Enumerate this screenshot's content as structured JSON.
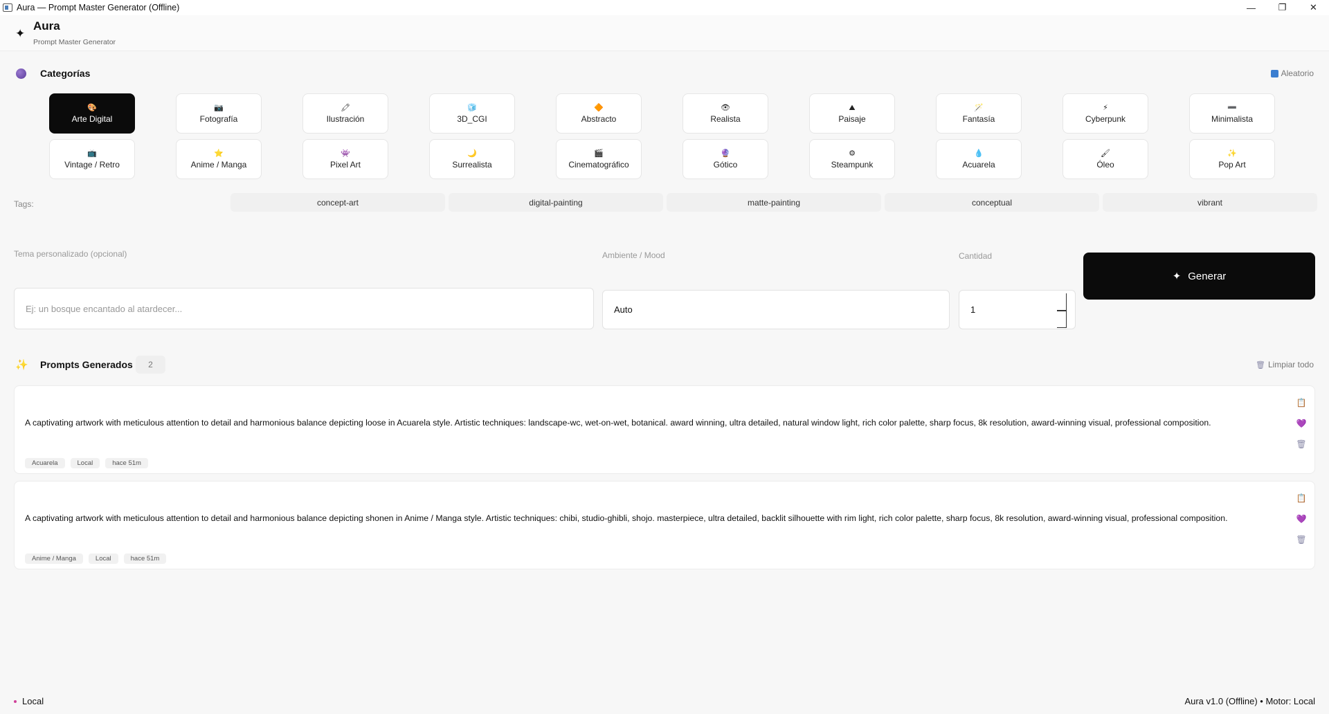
{
  "window": {
    "title": "Aura — Prompt Master Generator (Offline)",
    "controls": {
      "min": "—",
      "restore": "❐",
      "close": "✕"
    }
  },
  "header": {
    "logo_icon": "sparkle-icon",
    "logo": "✦",
    "name": "Aura",
    "subtitle": "Prompt Master Generator"
  },
  "categories": {
    "title": "Categorías",
    "random_label": "Aleatorio",
    "items": [
      {
        "icon": "🎨",
        "label": "Arte Digital",
        "active": true
      },
      {
        "icon": "📷",
        "label": "Fotografía"
      },
      {
        "icon": "🖍",
        "label": "Ilustración"
      },
      {
        "icon": "🧊",
        "label": "3D_CGI"
      },
      {
        "icon": "🔶",
        "label": "Abstracto"
      },
      {
        "icon": "👁",
        "label": "Realista"
      },
      {
        "icon": "⛰",
        "label": "Paisaje"
      },
      {
        "icon": "🪄",
        "label": "Fantasía"
      },
      {
        "icon": "⚡",
        "label": "Cyberpunk"
      },
      {
        "icon": "➖",
        "label": "Minimalista"
      },
      {
        "icon": "📺",
        "label": "Vintage / Retro"
      },
      {
        "icon": "⭐",
        "label": "Anime / Manga"
      },
      {
        "icon": "👾",
        "label": "Pixel Art"
      },
      {
        "icon": "🌙",
        "label": "Surrealista"
      },
      {
        "icon": "🎬",
        "label": "Cinematográfico"
      },
      {
        "icon": "🔮",
        "label": "Gótico"
      },
      {
        "icon": "⚙",
        "label": "Steampunk"
      },
      {
        "icon": "💧",
        "label": "Acuarela"
      },
      {
        "icon": "🖌",
        "label": "Óleo"
      },
      {
        "icon": "✨",
        "label": "Pop Art"
      }
    ]
  },
  "tags": {
    "label": "Tags:",
    "items": [
      "concept-art",
      "digital-painting",
      "matte-painting",
      "conceptual",
      "vibrant"
    ]
  },
  "form": {
    "theme_label": "Tema personalizado (opcional)",
    "theme_placeholder": "Ej: un bosque encantado al atardecer...",
    "mood_label": "Ambiente / Mood",
    "mood_value": "Auto",
    "quantity_label": "Cantidad",
    "quantity_value": "1",
    "generate_icon": "✦",
    "generate_label": "Generar"
  },
  "prompts": {
    "title": "Prompts Generados",
    "count": "2",
    "clear_label": "Limpiar todo",
    "items": [
      {
        "text": "A captivating artwork with meticulous attention to detail and harmonious balance depicting loose in Acuarela style. Artistic techniques: landscape-wc, wet-on-wet, botanical. award winning, ultra detailed, natural window light, rich color palette, sharp focus, 8k resolution, award-winning visual, professional composition.",
        "chips": [
          "Acuarela",
          "Local",
          "hace 51m"
        ]
      },
      {
        "text": "A captivating artwork with meticulous attention to detail and harmonious balance depicting shonen in Anime / Manga style. Artistic techniques: chibi, studio-ghibli, shojo. masterpiece, ultra detailed, backlit silhouette with rim light, rich color palette, sharp focus, 8k resolution, award-winning visual, professional composition.",
        "chips": [
          "Anime / Manga",
          "Local",
          "hace 51m"
        ]
      }
    ]
  },
  "status": {
    "left": "Local",
    "right": "Aura v1.0 (Offline) • Motor: Local"
  }
}
